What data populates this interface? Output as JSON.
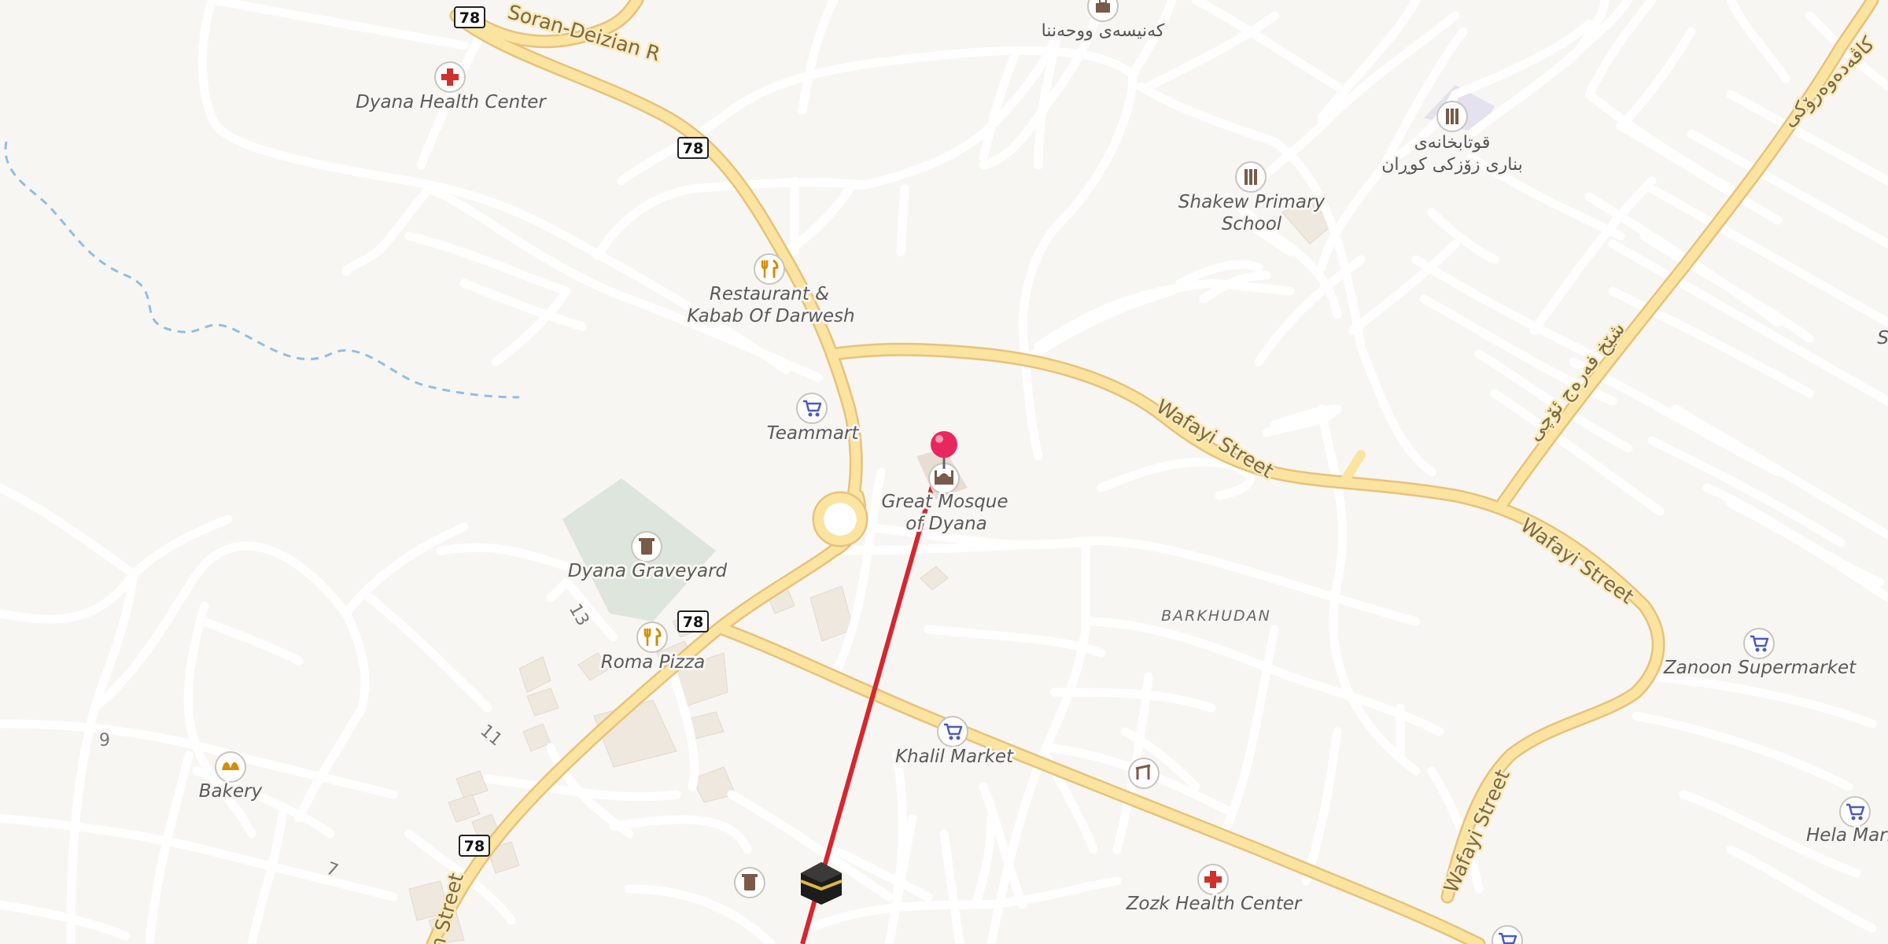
{
  "map": {
    "route_shield": "78",
    "streets": {
      "soran_deizian": "Soran-Deizian R",
      "wafayi_1": "Wafayi Street",
      "wafayi_2": "Wafayi Street",
      "wafayi_3": "Wafayi Street",
      "street_bottom_left": "m Street",
      "arabic_street_1": "کاڤەدەوەرۆکی",
      "arabic_street_2": "شێخ فەرەج ئۆچی"
    },
    "district": "BARKHUDAN",
    "road_numbers": {
      "n13": "13",
      "n11": "11",
      "n9": "9",
      "n7": "7"
    },
    "pois": {
      "dyana_health_center": "Dyana Health Center",
      "restaurant_line1": "Restaurant &",
      "restaurant_line2": "Kabab Of Darwesh",
      "teammart": "Teammart",
      "mosque_line1": "Great Mosque",
      "mosque_line2": "of Dyana",
      "graveyard": "Dyana Graveyard",
      "roma_pizza": "Roma Pizza",
      "bakery": "Bakery",
      "khalil_market": "Khalil Market",
      "zozk_health_center": "Zozk Health Center",
      "zanoon_supermarket": "Zanoon Supermarket",
      "hela_market": "Hela Mark",
      "school_line1": "Shakew Primary",
      "school_line2": "School",
      "library_line1": "قوتابخانەی",
      "library_line2": "بناری زۆزکی کوڕان",
      "top_arabic": "کەنیسەی ووحەننا",
      "partial_right": "Sc"
    },
    "colors": {
      "background": "#f8f6f3",
      "minor_road": "#ffffff",
      "major_road": "#fbe3a0",
      "major_road_casing": "#e7c27a",
      "direction_line": "#d7262e",
      "pin": "#e8275f",
      "stream": "#8cbfe8",
      "cemetery": "#dde5dc"
    }
  }
}
